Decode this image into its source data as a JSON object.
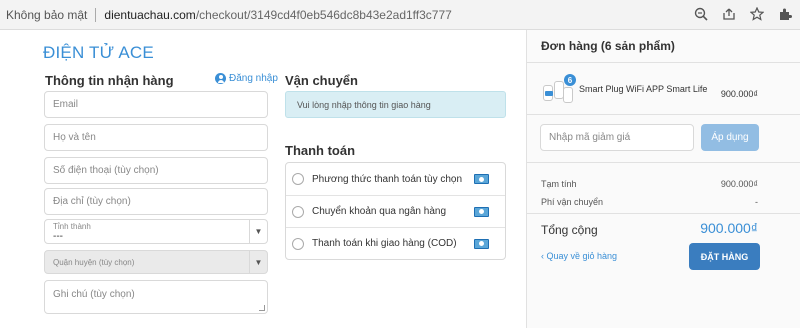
{
  "browser": {
    "secure_label": "Không bảo mật",
    "url_host": "dientuachau.com",
    "url_path": "/checkout/3149cd4f0eb546dc8b43e2ad1ff3c777",
    "icons": [
      "zoom-icon",
      "share-icon",
      "star-icon",
      "extensions-icon"
    ]
  },
  "brand": "ĐIỆN TỬ ACE",
  "shipping_info": {
    "title": "Thông tin nhận hàng",
    "login_label": "Đăng nhập",
    "email_placeholder": "Email",
    "name_placeholder": "Họ và tên",
    "phone_placeholder": "Số điện thoại (tùy chọn)",
    "address_placeholder": "Địa chỉ (tùy chọn)",
    "province_label": "Tỉnh thành",
    "province_value": "---",
    "district_label": "Quận huyện (tùy chọn)",
    "note_placeholder": "Ghi chú (tùy chọn)"
  },
  "delivery": {
    "title": "Vận chuyển",
    "notice": "Vui lòng nhập thông tin giao hàng"
  },
  "payment": {
    "title": "Thanh toán",
    "options": [
      {
        "label": "Phương thức thanh toán tùy chọn"
      },
      {
        "label": "Chuyển khoản qua ngân hàng"
      },
      {
        "label": "Thanh toán khi giao hàng (COD)"
      }
    ]
  },
  "order": {
    "title": "Đơn hàng (6 sản phẩm)",
    "item": {
      "name": "Smart Plug WiFi APP Smart Life",
      "price": "900.000₫",
      "quantity": "6"
    },
    "coupon_placeholder": "Nhập mã giảm giá",
    "apply_label": "Áp dụng",
    "subtotal_label": "Tạm tính",
    "subtotal_value": "900.000₫",
    "shipping_label": "Phí vận chuyển",
    "shipping_value": "-",
    "total_label": "Tổng cộng",
    "total_value": "900.000₫",
    "back_label": "Quay về giỏ hàng",
    "checkout_label": "ĐẶT HÀNG"
  },
  "colors": {
    "accent": "#3a8fd6",
    "button": "#3a7dbf",
    "button_disabled": "#92bde3",
    "notice_bg": "#d9eef4"
  }
}
